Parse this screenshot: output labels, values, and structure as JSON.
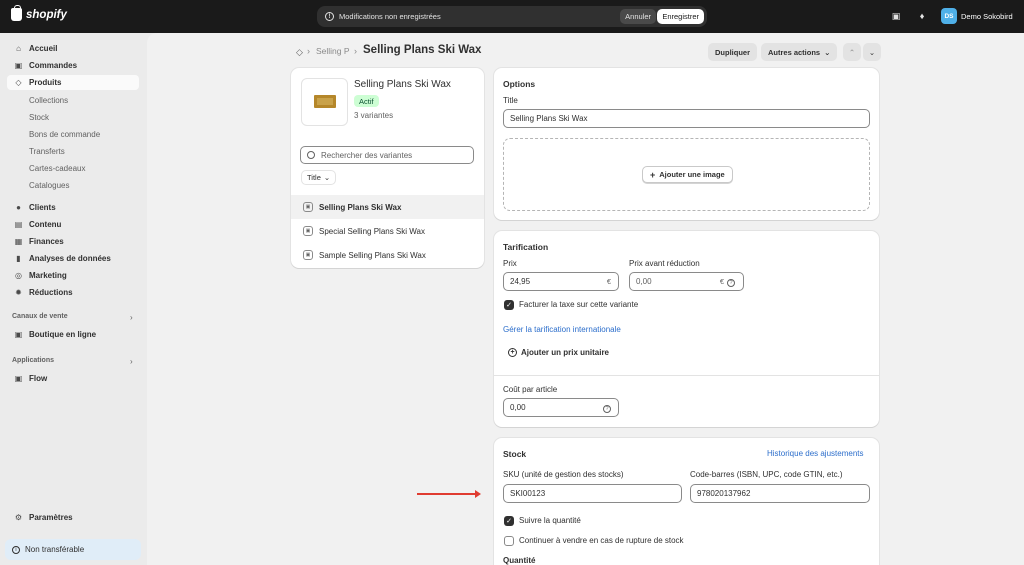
{
  "topbar": {
    "logo_text": "shopify",
    "unsaved_text": "Modifications non enregistrées",
    "cancel_label": "Annuler",
    "save_label": "Enregistrer",
    "avatar_initials": "DS",
    "store_name": "Demo Sokobird"
  },
  "sidebar": {
    "items": [
      {
        "label": "Accueil",
        "icon": "home-icon"
      },
      {
        "label": "Commandes",
        "icon": "inbox-icon"
      },
      {
        "label": "Produits",
        "icon": "tag-icon"
      },
      {
        "label": "Clients",
        "icon": "person-icon"
      },
      {
        "label": "Contenu",
        "icon": "content-icon"
      },
      {
        "label": "Finances",
        "icon": "bank-icon"
      },
      {
        "label": "Analyses de données",
        "icon": "chart-icon"
      },
      {
        "label": "Marketing",
        "icon": "target-icon"
      },
      {
        "label": "Réductions",
        "icon": "discount-icon"
      },
      {
        "label": "Boutique en ligne",
        "icon": "store-icon"
      },
      {
        "label": "Flow",
        "icon": "flow-icon"
      },
      {
        "label": "Paramètres",
        "icon": "gear-icon"
      }
    ],
    "sub_items": [
      "Collections",
      "Stock",
      "Bons de commande",
      "Transferts",
      "Cartes-cadeaux",
      "Catalogues"
    ],
    "sections": [
      "Canaux de vente",
      "Applications"
    ],
    "footer_label": "Non transférable"
  },
  "header": {
    "breadcrumb": "Selling P",
    "title": "Selling Plans Ski Wax",
    "duplicate_label": "Dupliquer",
    "more_label": "Autres actions"
  },
  "product": {
    "name": "Selling Plans Ski Wax",
    "status": "Actif",
    "variant_count": "3 variantes",
    "search_placeholder": "Rechercher des variantes",
    "filter_label": "Title",
    "variants": [
      "Selling Plans Ski Wax",
      "Special Selling Plans Ski Wax",
      "Sample Selling Plans Ski Wax"
    ]
  },
  "options": {
    "title": "Options",
    "field_label": "Title",
    "field_value": "Selling Plans Ski Wax",
    "add_image_label": "Ajouter une image"
  },
  "pricing": {
    "title": "Tarification",
    "price_label": "Prix",
    "price_value": "24,95",
    "compare_label": "Prix avant réduction",
    "compare_value": "0,00",
    "currency": "€",
    "tax_label": "Facturer la taxe sur cette variante",
    "intl_link": "Gérer la tarification internationale",
    "unit_price_label": "Ajouter un prix unitaire",
    "cost_label": "Coût par article",
    "cost_value": "0,00"
  },
  "stock": {
    "title": "Stock",
    "history_link": "Historique des ajustements",
    "sku_label": "SKU (unité de gestion des stocks)",
    "sku_value": "SKI00123",
    "barcode_label": "Code-barres (ISBN, UPC, code GTIN, etc.)",
    "barcode_value": "978020137962",
    "track_label": "Suivre la quantité",
    "continue_label": "Continuer à vendre en cas de rupture de stock",
    "quantity_label": "Quantité"
  }
}
